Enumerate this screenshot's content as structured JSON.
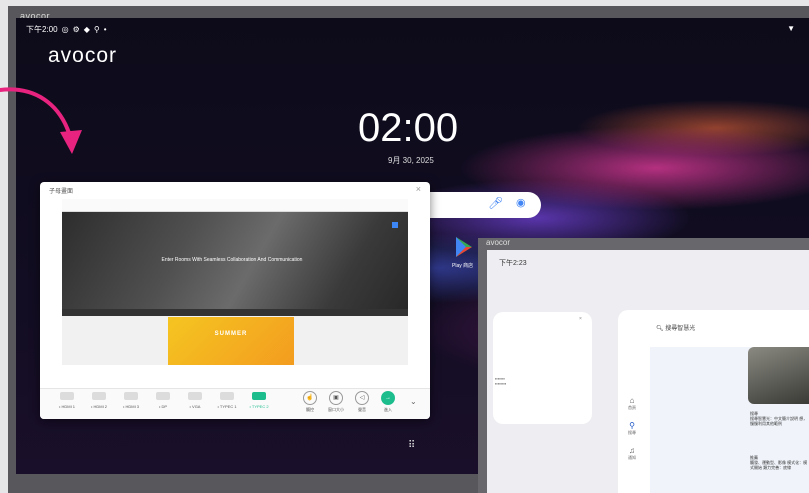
{
  "bezel_brand": "avocor",
  "status_bar": {
    "time": "下午2:00",
    "icons": [
      "alarm-icon",
      "gear-icon",
      "shield-icon",
      "usb-icon",
      "dot-icon"
    ]
  },
  "logo": "avocor",
  "clock": {
    "time": "02:00",
    "date": "9月 30, 2025"
  },
  "google_search": {
    "mic_icon": "mic-icon",
    "lens_icon": "lens-icon"
  },
  "apps": [
    {
      "label": "Play 商店"
    }
  ],
  "mirror_window": {
    "title": "子母畫面",
    "close": "×",
    "hero_text": "Enter Rooms With Seamless Collaboration And Communication",
    "banner_text": "SUMMER",
    "sources": [
      {
        "label": "• HDMI 1"
      },
      {
        "label": "• HDMI 2"
      },
      {
        "label": "• HDMI 3"
      },
      {
        "label": "• DP"
      },
      {
        "label": "• VGA"
      },
      {
        "label": "• TYPEC 1"
      },
      {
        "label": "• TYPEC 2",
        "active": true
      }
    ],
    "actions": [
      {
        "label": "觸控",
        "icon": "touch-icon"
      },
      {
        "label": "窗口大小",
        "icon": "resize-icon"
      },
      {
        "label": "聲音",
        "icon": "volume-icon"
      },
      {
        "label": "進入",
        "icon": "enter-icon"
      }
    ],
    "more": "⌄"
  },
  "second_panel": {
    "brand": "avocor",
    "status_time": "下午2:23",
    "search_placeholder": "搜尋智慧光",
    "nav": [
      {
        "label": "首頁",
        "icon": "home-icon"
      },
      {
        "label": "搜尋",
        "icon": "search-icon"
      },
      {
        "label": "通知",
        "icon": "bell-icon"
      }
    ],
    "items": [
      {
        "title": "搜尋",
        "desc": "搜尋智慧光：中文簡介說明 想，慢慢利用其他範例"
      },
      {
        "title": "推薦",
        "desc": "觸發、運動型、影像 模式化：模式開始 類力完善：底線"
      }
    ]
  },
  "colors": {
    "accent": "#1dbd8d",
    "arrow": "#e8237f",
    "brand_blue": "#1a55c4"
  }
}
